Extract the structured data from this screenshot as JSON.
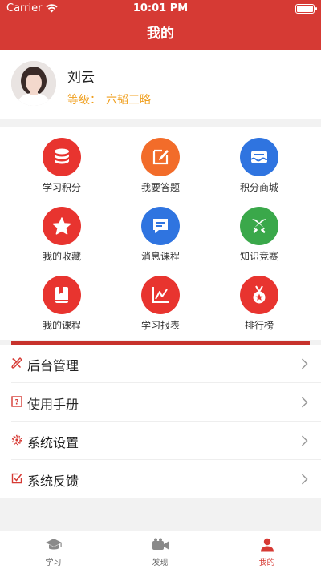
{
  "status_bar": {
    "carrier": "Carrier",
    "time": "10:01 PM"
  },
  "nav": {
    "title": "我的"
  },
  "profile": {
    "name": "刘云",
    "level_label": "等级：",
    "level_value": "六韬三略"
  },
  "grid": [
    {
      "label": "学习积分",
      "icon": "coins-stack-icon",
      "color": "#e8342f"
    },
    {
      "label": "我要答题",
      "icon": "edit-pen-icon",
      "color": "#f26c2a"
    },
    {
      "label": "积分商城",
      "icon": "mall-icon",
      "color": "#2f74e0"
    },
    {
      "label": "我的收藏",
      "icon": "star-icon",
      "color": "#e8342f"
    },
    {
      "label": "消息课程",
      "icon": "message-icon",
      "color": "#2f74e0"
    },
    {
      "label": "知识竞赛",
      "icon": "swords-icon",
      "color": "#3aa84a"
    },
    {
      "label": "我的课程",
      "icon": "bookmark-book-icon",
      "color": "#e8342f"
    },
    {
      "label": "学习报表",
      "icon": "chart-line-icon",
      "color": "#e8342f"
    },
    {
      "label": "排行榜",
      "icon": "medal-icon",
      "color": "#e8342f"
    }
  ],
  "menu": [
    {
      "label": "后台管理",
      "icon": "tools-icon"
    },
    {
      "label": "使用手册",
      "icon": "manual-icon"
    },
    {
      "label": "系统设置",
      "icon": "gear-icon"
    },
    {
      "label": "系统反馈",
      "icon": "feedback-icon"
    }
  ],
  "tabs": [
    {
      "label": "学习",
      "icon": "graduation-cap-icon",
      "active": false
    },
    {
      "label": "发现",
      "icon": "video-camera-icon",
      "active": false
    },
    {
      "label": "我的",
      "icon": "person-icon",
      "active": true
    }
  ],
  "colors": {
    "brand": "#d63a34",
    "level": "#f0a020"
  }
}
